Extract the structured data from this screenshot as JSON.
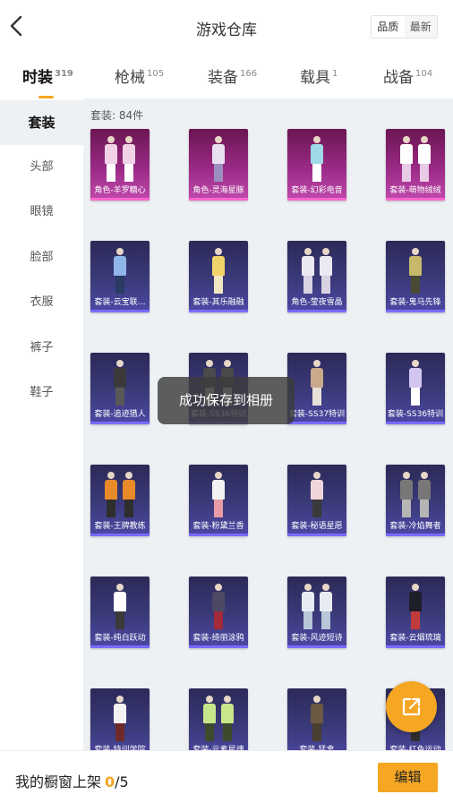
{
  "header": {
    "title": "游戏仓库",
    "sort_options": [
      "品质",
      "最新"
    ],
    "sort_selected": "品质"
  },
  "tabs": [
    {
      "label": "时装",
      "count": "319",
      "active": true
    },
    {
      "label": "枪械",
      "count": "105",
      "active": false
    },
    {
      "label": "装备",
      "count": "166",
      "active": false
    },
    {
      "label": "载具",
      "count": "1",
      "active": false
    },
    {
      "label": "战备",
      "count": "104",
      "active": false
    }
  ],
  "sidebar": {
    "items": [
      {
        "label": "套装",
        "active": true
      },
      {
        "label": "头部",
        "active": false
      },
      {
        "label": "眼镜",
        "active": false
      },
      {
        "label": "脸部",
        "active": false
      },
      {
        "label": "衣服",
        "active": false
      },
      {
        "label": "裤子",
        "active": false
      },
      {
        "label": "鞋子",
        "active": false
      }
    ]
  },
  "content": {
    "count_label": "套装: 84件",
    "items": [
      {
        "name": "角色-羊罗糖心",
        "rarity": "pink"
      },
      {
        "name": "角色-灵海星豚",
        "rarity": "pink"
      },
      {
        "name": "套装-幻彩电音",
        "rarity": "pink"
      },
      {
        "name": "套装-萌物绒绒",
        "rarity": "pink"
      },
      {
        "name": "套装-云宝联…",
        "rarity": "purple"
      },
      {
        "name": "套装-其乐融融",
        "rarity": "purple"
      },
      {
        "name": "角色-莹夜雪晶",
        "rarity": "purple"
      },
      {
        "name": "套装-鬼马先锋",
        "rarity": "purple"
      },
      {
        "name": "套装-追迹猎人",
        "rarity": "purple"
      },
      {
        "name": "套装-SS36特训",
        "rarity": "purple"
      },
      {
        "name": "套装-SS37特训",
        "rarity": "purple"
      },
      {
        "name": "套装-SS36特训",
        "rarity": "purple"
      },
      {
        "name": "套装-王牌教练",
        "rarity": "purple"
      },
      {
        "name": "套装-粉黛兰香",
        "rarity": "purple"
      },
      {
        "name": "套装-秘语星愿",
        "rarity": "purple"
      },
      {
        "name": "套装-冷焰舞者",
        "rarity": "purple"
      },
      {
        "name": "套装-纯白跃动",
        "rarity": "purple"
      },
      {
        "name": "套装-绮丽涂鸦",
        "rarity": "purple"
      },
      {
        "name": "套装-风迹短诗",
        "rarity": "purple"
      },
      {
        "name": "套装-云烟琉璃",
        "rarity": "purple"
      },
      {
        "name": "套装-特训学院",
        "rarity": "purple"
      },
      {
        "name": "套装-元素星魂",
        "rarity": "purple"
      },
      {
        "name": "套装-猛禽",
        "rarity": "purple"
      },
      {
        "name": "套装-红色运动",
        "rarity": "purple"
      }
    ]
  },
  "toast": {
    "text": "成功保存到相册"
  },
  "bottom": {
    "shelf_label": "我的橱窗上架",
    "shelf_current": "0",
    "shelf_total": "/5",
    "edit_label": "编辑"
  },
  "icons": {
    "back": "chevron-left-icon",
    "fab": "share-external-icon"
  },
  "colors": {
    "accent": "#f5a623",
    "rarity_pink": "#c04aad",
    "rarity_purple": "#4d48a6"
  }
}
